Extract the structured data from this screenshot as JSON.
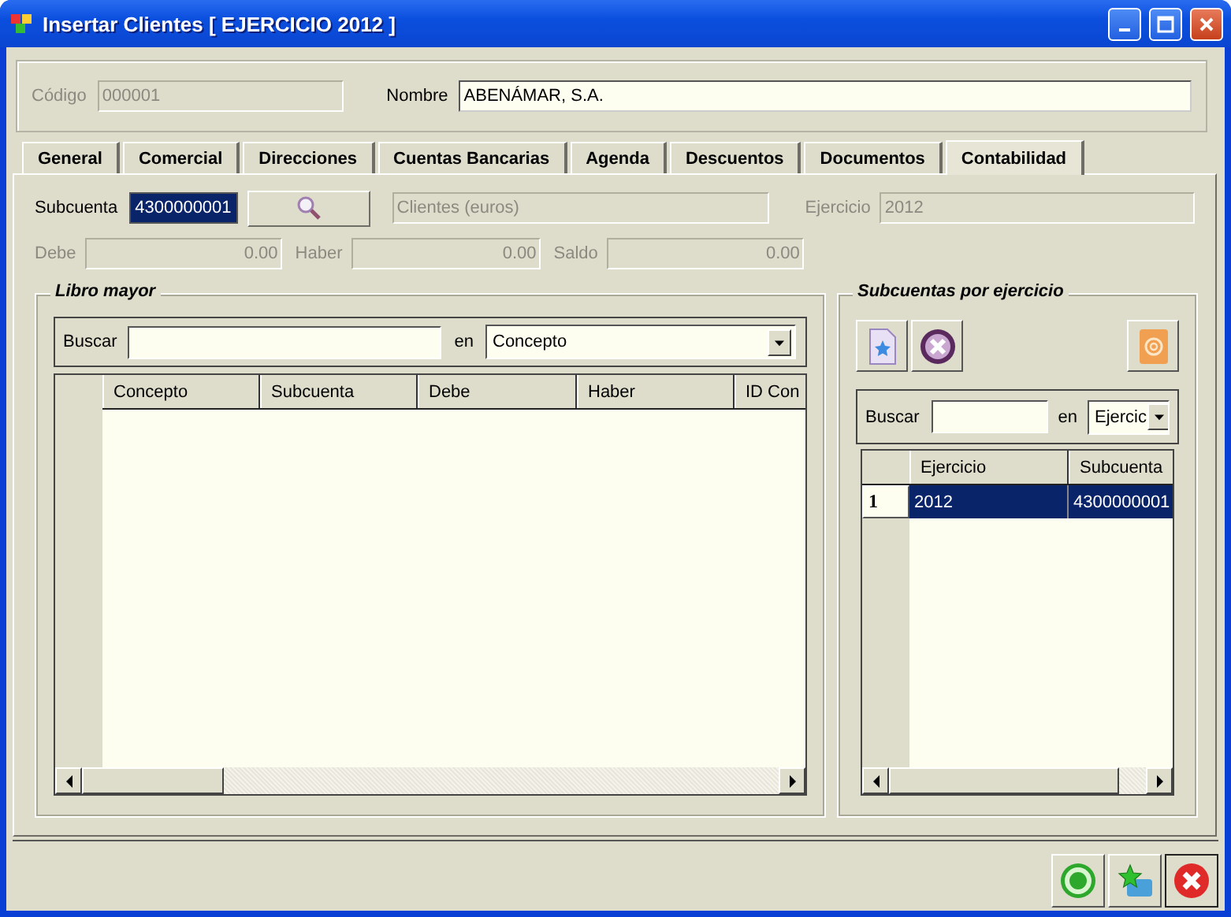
{
  "window": {
    "title": "Insertar Clientes [ EJERCICIO 2012 ]"
  },
  "header": {
    "codigo": {
      "label": "Código",
      "value": "000001",
      "disabled": true
    },
    "nombre": {
      "label": "Nombre",
      "value": "ABENÁMAR, S.A.",
      "disabled": false
    }
  },
  "tabs": [
    {
      "label": "General",
      "selected": false
    },
    {
      "label": "Comercial",
      "selected": false
    },
    {
      "label": "Direcciones",
      "selected": false
    },
    {
      "label": "Cuentas Bancarias",
      "selected": false
    },
    {
      "label": "Agenda",
      "selected": false
    },
    {
      "label": "Descuentos",
      "selected": false
    },
    {
      "label": "Documentos",
      "selected": false
    },
    {
      "label": "Contabilidad",
      "selected": true
    }
  ],
  "contabilidad": {
    "subcuenta": {
      "label": "Subcuenta",
      "value": "4300000001",
      "selected": true
    },
    "descripcion": {
      "value": "Clientes (euros)",
      "disabled": true
    },
    "ejercicio": {
      "label": "Ejercicio",
      "value": "2012",
      "disabled": true
    },
    "totals": [
      {
        "label": "Debe",
        "value": "0.00",
        "disabled": true
      },
      {
        "label": "Haber",
        "value": "0.00",
        "disabled": true
      },
      {
        "label": "Saldo",
        "value": "0.00",
        "disabled": true
      }
    ]
  },
  "libro_mayor": {
    "title": "Libro mayor",
    "search": {
      "label": "Buscar",
      "in_label": "en",
      "field": "Concepto"
    },
    "columns": [
      "Concepto",
      "Subcuenta",
      "Debe",
      "Haber",
      "ID Con"
    ]
  },
  "subcuentas": {
    "title": "Subcuentas por ejercicio",
    "search": {
      "label": "Buscar",
      "in_label": "en",
      "field": "Ejercic"
    },
    "columns": [
      "Ejercicio",
      "Subcuenta"
    ],
    "rows": [
      {
        "number": "1",
        "cells": [
          "2012",
          "4300000001"
        ],
        "selected": true
      }
    ]
  }
}
